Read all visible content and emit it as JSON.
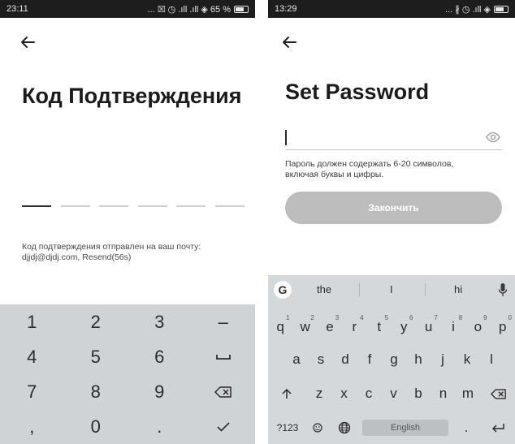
{
  "left_screen": {
    "status": {
      "time": "23:11",
      "icons_text": "... ☒ ◷ .ıll .ıll ◈ 65 %"
    },
    "title": "Код Подтверждения",
    "code_cells": 6,
    "info_line1": "Код подтверждения отправлен на ваш почту:",
    "info_line2": "djjdj@djdj.com, Resend(56s)",
    "numpad": [
      [
        "1",
        "2",
        "3",
        "–"
      ],
      [
        "4",
        "5",
        "6",
        "space"
      ],
      [
        "7",
        "8",
        "9",
        "backspace"
      ],
      [
        ",",
        "0",
        ".",
        "check"
      ]
    ]
  },
  "right_screen": {
    "status": {
      "time": "13:29",
      "icons_text": "... ∦ ◷ .ıll ◈"
    },
    "title": "Set Password",
    "password": {
      "value": "",
      "placeholder": ""
    },
    "hint_line1": "Пароль должен содержать 6-20 символов,",
    "hint_line2": "включая буквы и цифры.",
    "finish_label": "Закончить",
    "keyboard": {
      "suggestions": [
        "the",
        "I",
        "hi"
      ],
      "row1": [
        [
          "q",
          "1"
        ],
        [
          "w",
          "2"
        ],
        [
          "e",
          "3"
        ],
        [
          "r",
          "4"
        ],
        [
          "t",
          "5"
        ],
        [
          "y",
          "6"
        ],
        [
          "u",
          "7"
        ],
        [
          "i",
          "8"
        ],
        [
          "o",
          "9"
        ],
        [
          "p",
          "0"
        ]
      ],
      "row2": [
        "a",
        "s",
        "d",
        "f",
        "g",
        "h",
        "j",
        "k",
        "l"
      ],
      "row3": [
        "z",
        "x",
        "c",
        "v",
        "b",
        "n",
        "m"
      ],
      "symbols_label": "?123",
      "space_label": "English",
      "period": "."
    }
  },
  "colors": {
    "button_disabled": "#bdbdbd",
    "keyboard_bg": "#d4d8db",
    "numpad_bg": "#cfd3d6"
  }
}
